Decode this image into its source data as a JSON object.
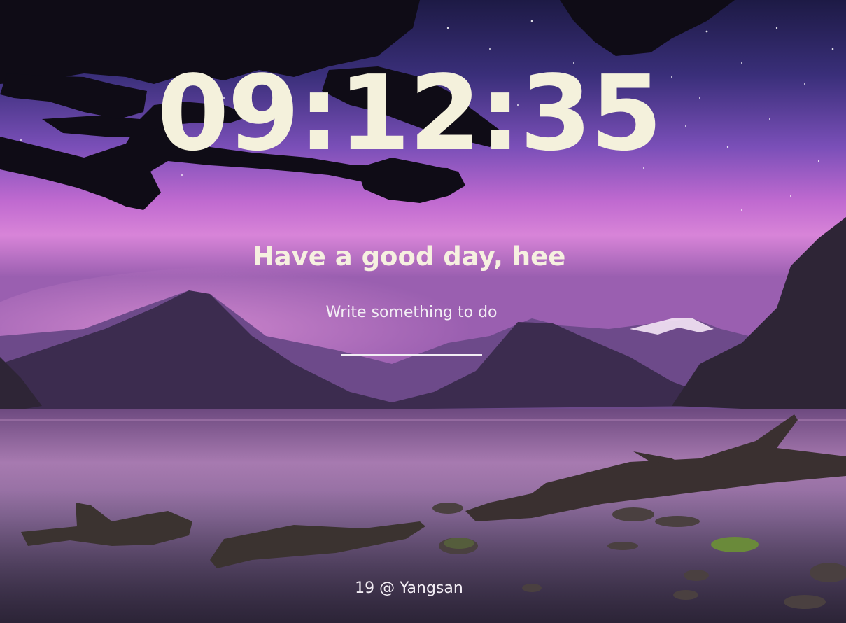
{
  "clock": {
    "time": "09:12:35"
  },
  "greeting": {
    "text": "Have a good day, hee"
  },
  "todo": {
    "placeholder": "Write something to do",
    "value": ""
  },
  "weather": {
    "text": "19 @ Yangsan"
  },
  "background": {
    "scene": "night-lake-mountains"
  }
}
